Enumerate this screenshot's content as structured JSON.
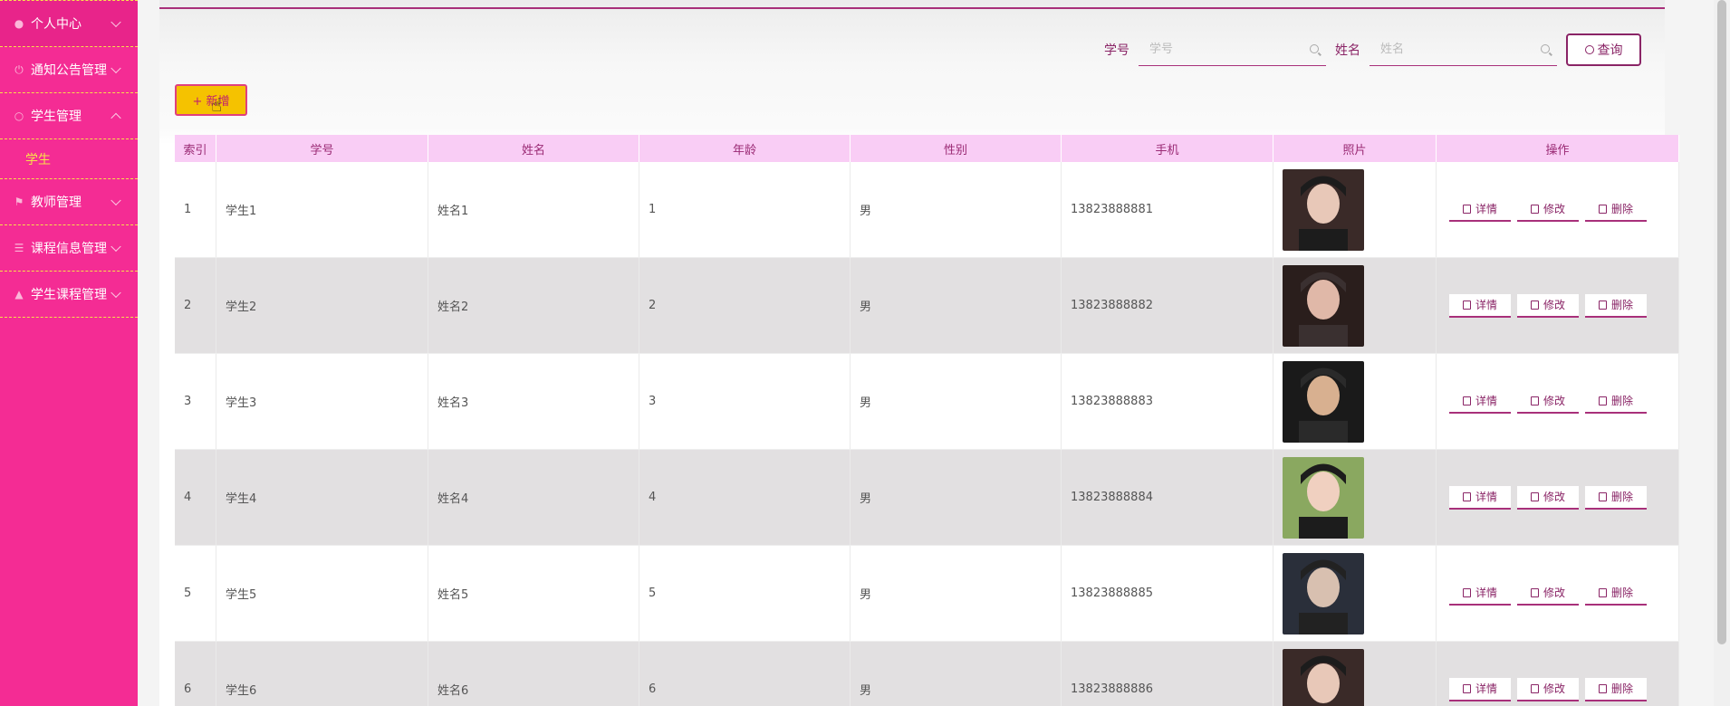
{
  "sidebar": {
    "items": [
      {
        "label": "个人中心",
        "icon": "user-icon",
        "expanded": false
      },
      {
        "label": "通知公告管理",
        "icon": "power-icon",
        "expanded": false
      },
      {
        "label": "学生管理",
        "icon": "compass-icon",
        "expanded": true
      },
      {
        "label": "教师管理",
        "icon": "flag-icon",
        "expanded": false
      },
      {
        "label": "课程信息管理",
        "icon": "list-icon",
        "expanded": false
      },
      {
        "label": "学生课程管理",
        "icon": "stamp-icon",
        "expanded": false
      }
    ],
    "sub_item": "学生"
  },
  "search": {
    "label1": "学号",
    "placeholder1": "学号",
    "label2": "姓名",
    "placeholder2": "姓名",
    "button": "查询"
  },
  "add_button": "+ 新增",
  "table": {
    "headers": [
      "索引",
      "学号",
      "姓名",
      "年龄",
      "性别",
      "手机",
      "照片",
      "操作"
    ],
    "ops": {
      "detail": "详情",
      "edit": "修改",
      "delete": "删除"
    },
    "rows": [
      {
        "index": "1",
        "sid": "学生1",
        "name": "姓名1",
        "age": "1",
        "gender": "男",
        "phone": "13823888881"
      },
      {
        "index": "2",
        "sid": "学生2",
        "name": "姓名2",
        "age": "2",
        "gender": "男",
        "phone": "13823888882"
      },
      {
        "index": "3",
        "sid": "学生3",
        "name": "姓名3",
        "age": "3",
        "gender": "男",
        "phone": "13823888883"
      },
      {
        "index": "4",
        "sid": "学生4",
        "name": "姓名4",
        "age": "4",
        "gender": "男",
        "phone": "13823888884"
      },
      {
        "index": "5",
        "sid": "学生5",
        "name": "姓名5",
        "age": "5",
        "gender": "男",
        "phone": "13823888885"
      },
      {
        "index": "6",
        "sid": "学生6",
        "name": "姓名6",
        "age": "6",
        "gender": "男",
        "phone": "13823888886"
      }
    ]
  },
  "colors": {
    "sidebar_bg": "#f42c94",
    "accent": "#8a2466",
    "header_bg": "#f9cdf5",
    "add_btn": "#f5c200"
  }
}
